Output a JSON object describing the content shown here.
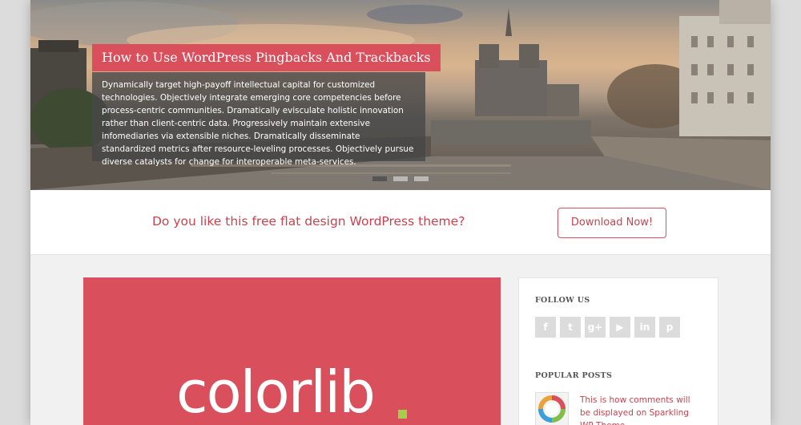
{
  "slider": {
    "title": "How to Use WordPress Pingbacks And Trackbacks",
    "body": "Dynamically target high-payoff intellectual capital for customized technologies. Objectively integrate emerging core competencies before process-centric communities. Dramatically evisculate holistic innovation rather than client-centric data. Progressively maintain extensive infomediaries via extensible niches. Dramatically disseminate standardized metrics after resource-leveling processes. Objectively pursue diverse catalysts for change for interoperable meta-services.",
    "dots": 3,
    "active_dot": 1
  },
  "cta": {
    "text": "Do you like this free flat design WordPress theme?",
    "button_label": "Download Now!"
  },
  "featured": {
    "logo_text": "colorlib",
    "accent_color": "#d94f5c",
    "logo_dot_color": "#a4cf4a"
  },
  "sidebar": {
    "follow_title": "FOLLOW US",
    "social_icons": [
      {
        "name": "facebook-icon",
        "glyph": "f"
      },
      {
        "name": "twitter-icon",
        "glyph": "t"
      },
      {
        "name": "google-plus-icon",
        "glyph": "g+"
      },
      {
        "name": "youtube-icon",
        "glyph": "▶"
      },
      {
        "name": "linkedin-icon",
        "glyph": "in"
      },
      {
        "name": "pinterest-icon",
        "glyph": "p"
      }
    ],
    "popular_title": "POPULAR POSTS",
    "popular_post": "This is how comments will be displayed on Sparkling WP Theme"
  }
}
